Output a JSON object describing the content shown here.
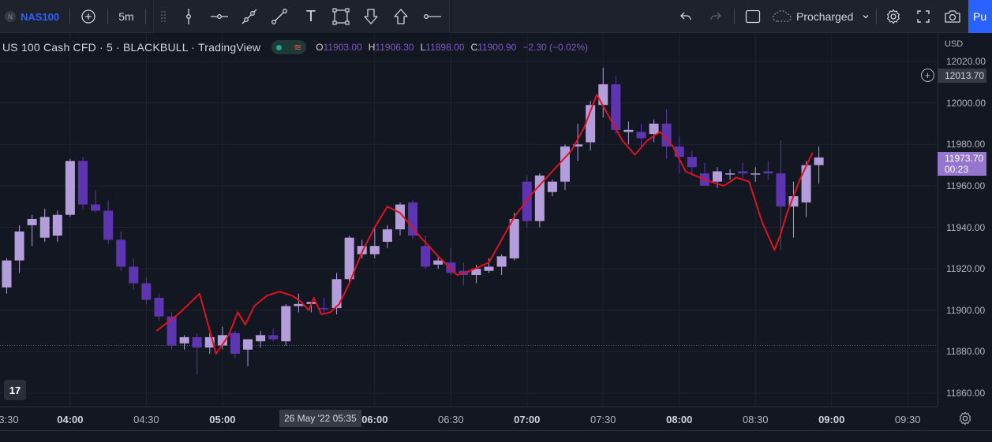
{
  "toolbar": {
    "symbol_badge": "N",
    "symbol": "NAS100",
    "add_symbol_icon": "plus-circle-icon",
    "interval": "5m",
    "undo_icon": "undo-icon",
    "redo_icon": "redo-icon",
    "layout_icon": "square-icon",
    "cloud_label": "Procharged",
    "settings_icon": "gear-icon",
    "fullscreen_icon": "fullscreen-icon",
    "snapshot_icon": "camera-icon",
    "publish_label": "Pu"
  },
  "drawing_toolbar": {
    "tools": [
      "drag-handle-icon",
      "vertical-line-icon",
      "horizontal-line-icon",
      "trend-line-icon",
      "line-icon",
      "text-tool-icon",
      "rectangle-icon",
      "arrow-down-icon",
      "arrow-up-icon",
      "horizontal-ray-icon"
    ],
    "text_tool_label": "T"
  },
  "legend": {
    "title": "US 100 Cash CFD · 5 · BLACKBULL · TradingView",
    "status_wave": "≋",
    "o_label": "O",
    "o_value": "11903.00",
    "h_label": "H",
    "h_value": "11906.30",
    "l_label": "L",
    "l_value": "11898.00",
    "c_label": "C",
    "c_value": "11900.90",
    "change": "−2.30 (−0.02%)"
  },
  "price_axis": {
    "currency": "USD",
    "crosshair_price": "12013.70",
    "last_price": "11973.70",
    "countdown": "00:23"
  },
  "time_axis": {
    "crosshair_time": "26 May '22   05:35"
  },
  "logo": "17",
  "colors": {
    "background": "#131722",
    "bull": "#b39ddb",
    "bear": "#5e35b1",
    "line": "#e0121f",
    "accent": "#2962ff",
    "price_tag": "#9575cd"
  },
  "chart_data": {
    "type": "candlestick",
    "title": "US 100 Cash CFD · 5 · BLACKBULL · TradingView",
    "ylim": [
      11855,
      12025
    ],
    "y_ticks": [
      11860,
      11880,
      11900,
      11920,
      11940,
      11960,
      11980,
      12000,
      12020
    ],
    "y_tick_labels": [
      "11860.00",
      "11880.00",
      "11900.00",
      "11920.00",
      "11940.00",
      "11960.00",
      "11980.00",
      "12000.00",
      "12020.00"
    ],
    "x_ticks": [
      {
        "label": "3:30",
        "major": false,
        "slot": -1
      },
      {
        "label": "04:00",
        "major": true,
        "slot": 5
      },
      {
        "label": "04:30",
        "major": false,
        "slot": 11
      },
      {
        "label": "05:00",
        "major": true,
        "slot": 17
      },
      {
        "label": "06:00",
        "major": true,
        "slot": 29
      },
      {
        "label": "06:30",
        "major": false,
        "slot": 35
      },
      {
        "label": "07:00",
        "major": true,
        "slot": 41
      },
      {
        "label": "07:30",
        "major": false,
        "slot": 47
      },
      {
        "label": "08:00",
        "major": true,
        "slot": 53
      },
      {
        "label": "08:30",
        "major": false,
        "slot": 59
      },
      {
        "label": "09:00",
        "major": true,
        "slot": 65
      },
      {
        "label": "09:30",
        "major": false,
        "slot": 71
      }
    ],
    "candles": [
      {
        "o": 11911,
        "h": 11925,
        "l": 11908,
        "c": 11924
      },
      {
        "o": 11924,
        "h": 11941,
        "l": 11918,
        "c": 11938
      },
      {
        "o": 11941,
        "h": 11946,
        "l": 11931,
        "c": 11944
      },
      {
        "o": 11935,
        "h": 11949,
        "l": 11933,
        "c": 11945
      },
      {
        "o": 11936,
        "h": 11948,
        "l": 11933,
        "c": 11946
      },
      {
        "o": 11946,
        "h": 11973,
        "l": 11945,
        "c": 11972
      },
      {
        "o": 11972,
        "h": 11974,
        "l": 11949,
        "c": 11951
      },
      {
        "o": 11951,
        "h": 11958,
        "l": 11947,
        "c": 11948
      },
      {
        "o": 11948,
        "h": 11953,
        "l": 11932,
        "c": 11934
      },
      {
        "o": 11934,
        "h": 11938,
        "l": 11919,
        "c": 11921
      },
      {
        "o": 11921,
        "h": 11925,
        "l": 11910,
        "c": 11913
      },
      {
        "o": 11913,
        "h": 11916,
        "l": 11903,
        "c": 11905
      },
      {
        "o": 11906,
        "h": 11908,
        "l": 11895,
        "c": 11897
      },
      {
        "o": 11897,
        "h": 11899,
        "l": 11881,
        "c": 11883
      },
      {
        "o": 11884,
        "h": 11888,
        "l": 11881,
        "c": 11887
      },
      {
        "o": 11887,
        "h": 11889,
        "l": 11869,
        "c": 11882
      },
      {
        "o": 11882,
        "h": 11889,
        "l": 11879,
        "c": 11887
      },
      {
        "o": 11883,
        "h": 11892,
        "l": 11881,
        "c": 11888
      },
      {
        "o": 11889,
        "h": 11890,
        "l": 11877,
        "c": 11879
      },
      {
        "o": 11881,
        "h": 11886,
        "l": 11873,
        "c": 11886
      },
      {
        "o": 11885,
        "h": 11890,
        "l": 11882,
        "c": 11888
      },
      {
        "o": 11888,
        "h": 11891,
        "l": 11885,
        "c": 11886
      },
      {
        "o": 11885,
        "h": 11903,
        "l": 11883,
        "c": 11902
      },
      {
        "o": 11902,
        "h": 11908,
        "l": 11899,
        "c": 11903
      },
      {
        "o": 11903,
        "h": 11904,
        "l": 11899,
        "c": 11904
      },
      {
        "o": 11901,
        "h": 11906,
        "l": 11898,
        "c": 11900.9
      },
      {
        "o": 11901,
        "h": 11918,
        "l": 11898,
        "c": 11915
      },
      {
        "o": 11915,
        "h": 11936,
        "l": 11913,
        "c": 11935
      },
      {
        "o": 11927,
        "h": 11934,
        "l": 11925,
        "c": 11931
      },
      {
        "o": 11927,
        "h": 11940,
        "l": 11925,
        "c": 11931
      },
      {
        "o": 11933,
        "h": 11941,
        "l": 11930,
        "c": 11939
      },
      {
        "o": 11939,
        "h": 11952,
        "l": 11936,
        "c": 11951
      },
      {
        "o": 11952,
        "h": 11953,
        "l": 11934,
        "c": 11936
      },
      {
        "o": 11931,
        "h": 11936,
        "l": 11920,
        "c": 11921
      },
      {
        "o": 11922,
        "h": 11926,
        "l": 11920,
        "c": 11924
      },
      {
        "o": 11923,
        "h": 11930,
        "l": 11917,
        "c": 11918
      },
      {
        "o": 11919,
        "h": 11923,
        "l": 11912,
        "c": 11917
      },
      {
        "o": 11917,
        "h": 11922,
        "l": 11913,
        "c": 11920
      },
      {
        "o": 11919,
        "h": 11925,
        "l": 11918,
        "c": 11921
      },
      {
        "o": 11921,
        "h": 11927,
        "l": 11917,
        "c": 11926
      },
      {
        "o": 11925,
        "h": 11947,
        "l": 11924,
        "c": 11944
      },
      {
        "o": 11962,
        "h": 11965,
        "l": 11940,
        "c": 11943
      },
      {
        "o": 11943,
        "h": 11966,
        "l": 11940,
        "c": 11965
      },
      {
        "o": 11957,
        "h": 11963,
        "l": 11955,
        "c": 11962
      },
      {
        "o": 11962,
        "h": 11980,
        "l": 11958,
        "c": 11979
      },
      {
        "o": 11979,
        "h": 11990,
        "l": 11972,
        "c": 11980
      },
      {
        "o": 11981,
        "h": 12001,
        "l": 11977,
        "c": 11999
      },
      {
        "o": 11999,
        "h": 12017,
        "l": 11993,
        "c": 12009
      },
      {
        "o": 12009,
        "h": 12013,
        "l": 11985,
        "c": 11987
      },
      {
        "o": 11986,
        "h": 11991,
        "l": 11980,
        "c": 11987
      },
      {
        "o": 11986,
        "h": 11990,
        "l": 11979,
        "c": 11983
      },
      {
        "o": 11985,
        "h": 11992,
        "l": 11981,
        "c": 11990
      },
      {
        "o": 11990,
        "h": 11997,
        "l": 11973,
        "c": 11979
      },
      {
        "o": 11979,
        "h": 11984,
        "l": 11966,
        "c": 11974
      },
      {
        "o": 11974,
        "h": 11977,
        "l": 11965,
        "c": 11969
      },
      {
        "o": 11966,
        "h": 11971,
        "l": 11961,
        "c": 11960
      },
      {
        "o": 11962,
        "h": 11969,
        "l": 11959,
        "c": 11967
      },
      {
        "o": 11966,
        "h": 11968,
        "l": 11963,
        "c": 11966
      },
      {
        "o": 11967,
        "h": 11971,
        "l": 11963,
        "c": 11966
      },
      {
        "o": 11966,
        "h": 11969,
        "l": 11962,
        "c": 11966
      },
      {
        "o": 11967,
        "h": 11972,
        "l": 11963,
        "c": 11966
      },
      {
        "o": 11966,
        "h": 11982,
        "l": 11929,
        "c": 11950
      },
      {
        "o": 11950,
        "h": 11962,
        "l": 11935,
        "c": 11955
      },
      {
        "o": 11952,
        "h": 11972,
        "l": 11945,
        "c": 11970
      },
      {
        "o": 11970,
        "h": 11979,
        "l": 11961,
        "c": 11973.7
      }
    ],
    "line_series": [
      {
        "slot": 11.8,
        "y": 11890
      },
      {
        "slot": 13.5,
        "y": 11898
      },
      {
        "slot": 15.2,
        "y": 11908
      },
      {
        "slot": 16.5,
        "y": 11879
      },
      {
        "slot": 17.5,
        "y": 11888
      },
      {
        "slot": 18.2,
        "y": 11899
      },
      {
        "slot": 18.8,
        "y": 11893
      },
      {
        "slot": 19.5,
        "y": 11902
      },
      {
        "slot": 20.5,
        "y": 11907
      },
      {
        "slot": 21.5,
        "y": 11909
      },
      {
        "slot": 22.5,
        "y": 11907
      },
      {
        "slot": 23.2,
        "y": 11904
      },
      {
        "slot": 23.8,
        "y": 11900
      },
      {
        "slot": 24.2,
        "y": 11906
      },
      {
        "slot": 24.8,
        "y": 11898
      },
      {
        "slot": 25.5,
        "y": 11899
      },
      {
        "slot": 26.2,
        "y": 11903
      },
      {
        "slot": 27.0,
        "y": 11913
      },
      {
        "slot": 28.0,
        "y": 11928
      },
      {
        "slot": 29.0,
        "y": 11940
      },
      {
        "slot": 30.0,
        "y": 11950
      },
      {
        "slot": 31.0,
        "y": 11947
      },
      {
        "slot": 32.5,
        "y": 11936
      },
      {
        "slot": 34.0,
        "y": 11926
      },
      {
        "slot": 35.5,
        "y": 11917
      },
      {
        "slot": 36.5,
        "y": 11919
      },
      {
        "slot": 38.0,
        "y": 11923
      },
      {
        "slot": 39.0,
        "y": 11934
      },
      {
        "slot": 40.0,
        "y": 11945
      },
      {
        "slot": 41.5,
        "y": 11957
      },
      {
        "slot": 43.0,
        "y": 11967
      },
      {
        "slot": 44.5,
        "y": 11977
      },
      {
        "slot": 45.5,
        "y": 11988
      },
      {
        "slot": 46.5,
        "y": 12004
      },
      {
        "slot": 47.5,
        "y": 11993
      },
      {
        "slot": 48.5,
        "y": 11982
      },
      {
        "slot": 49.5,
        "y": 11975
      },
      {
        "slot": 50.5,
        "y": 11982
      },
      {
        "slot": 51.5,
        "y": 11986
      },
      {
        "slot": 52.5,
        "y": 11979
      },
      {
        "slot": 53.5,
        "y": 11967
      },
      {
        "slot": 55.0,
        "y": 11963
      },
      {
        "slot": 56.5,
        "y": 11960
      },
      {
        "slot": 57.5,
        "y": 11964
      },
      {
        "slot": 58.5,
        "y": 11962
      },
      {
        "slot": 59.5,
        "y": 11943
      },
      {
        "slot": 60.5,
        "y": 11929
      },
      {
        "slot": 61.0,
        "y": 11937
      },
      {
        "slot": 61.5,
        "y": 11947
      },
      {
        "slot": 62.5,
        "y": 11963
      },
      {
        "slot": 63.5,
        "y": 11976
      }
    ]
  }
}
